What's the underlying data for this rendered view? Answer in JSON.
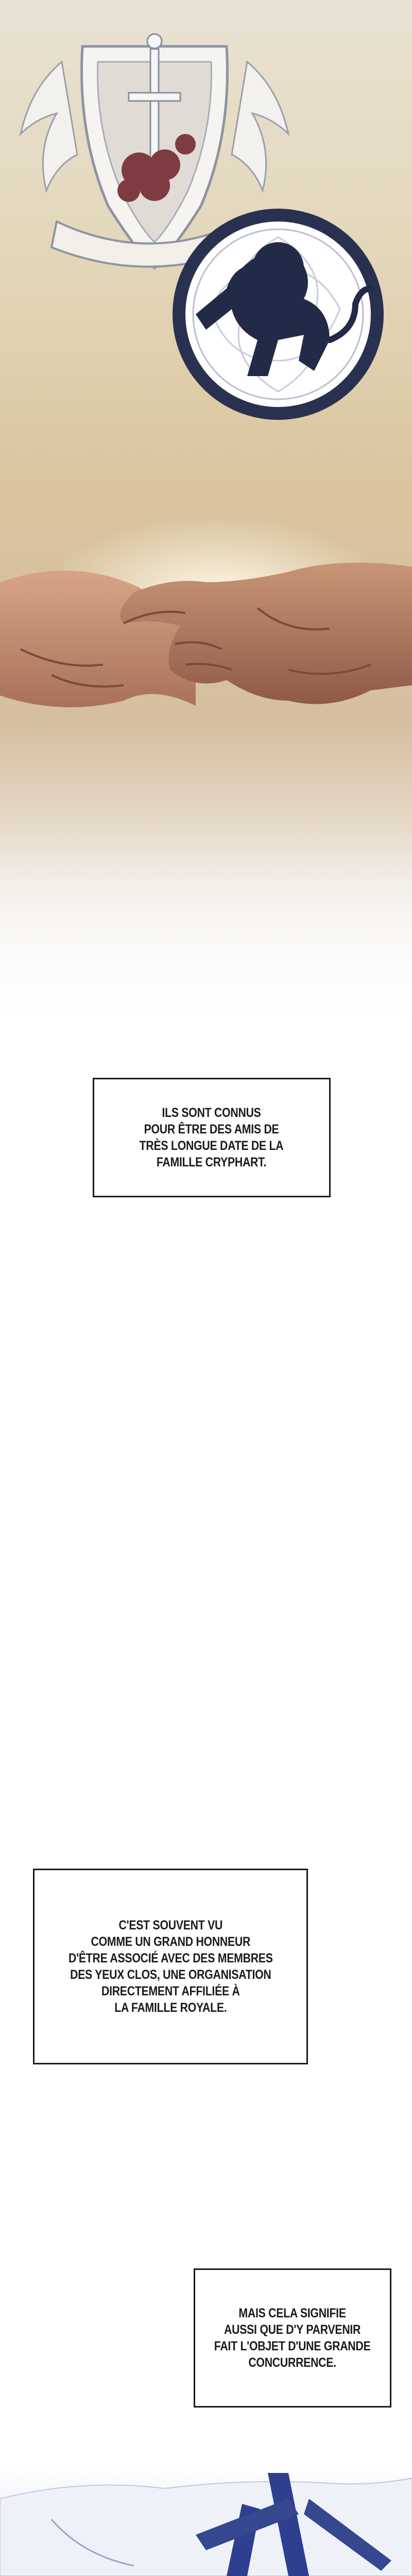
{
  "captions": [
    {
      "text": "ILS SONT CONNUS\nPOUR ÊTRE DES AMIS DE\nTRÈS LONGUE DATE DE LA\nFAMILLE CRYPHART."
    },
    {
      "text": "C'EST SOUVENT VU\nCOMME UN GRAND HONNEUR\nD'ÊTRE ASSOCIÉ AVEC DES MEMBRES\nDES YEUX CLOS, UNE ORGANISATION\nDIRECTEMENT AFFILIÉE À\nLA FAMILLE ROYALE."
    },
    {
      "text": "MAIS CELA SIGNIFIE\nAUSSI QUE D'Y PARVENIR\nFAIT L'OBJET D'UNE GRANDE\nCONCURRENCE."
    }
  ],
  "colors": {
    "sky_top": "#e9e2d3",
    "crest_navy": "#232a47",
    "skin": "#c99576",
    "rose": "#7e3b40"
  },
  "icons": [
    "sword-crest-icon",
    "lion-emblem-icon",
    "handshake-illustration"
  ]
}
